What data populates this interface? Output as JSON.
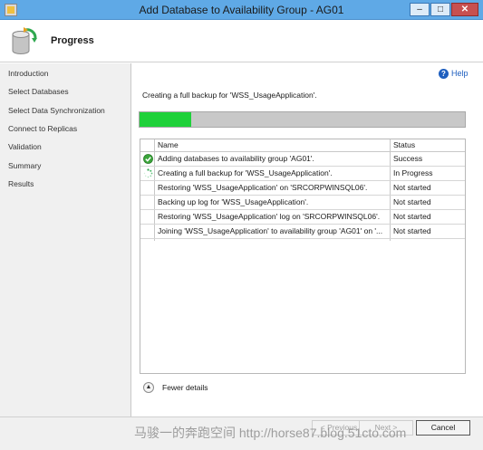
{
  "window": {
    "title": "Add Database to Availability Group - AG01",
    "minimize_glyph": "–",
    "maximize_glyph": "□",
    "close_glyph": "✕"
  },
  "header": {
    "title": "Progress",
    "icon": "database-sync-icon"
  },
  "sidebar": {
    "items": [
      "Introduction",
      "Select Databases",
      "Select Data Synchronization",
      "Connect to Replicas",
      "Validation",
      "Summary",
      "Results"
    ]
  },
  "help": {
    "label": "Help",
    "icon_glyph": "?"
  },
  "status_message": "Creating a full backup for 'WSS_UsageApplication'.",
  "progress": {
    "fraction": 0.16
  },
  "grid": {
    "columns": [
      "Name",
      "Status"
    ],
    "rows": [
      {
        "name": "Adding databases to availability group 'AG01'.",
        "status": "Success",
        "icon": "success-check-icon"
      },
      {
        "name": "Creating a full backup for 'WSS_UsageApplication'.",
        "status": "In Progress",
        "icon": "in-progress-spinner-icon"
      },
      {
        "name": "Restoring 'WSS_UsageApplication' on 'SRCORPWINSQL06'.",
        "status": "Not started",
        "icon": ""
      },
      {
        "name": "Backing up log for 'WSS_UsageApplication'.",
        "status": "Not started",
        "icon": ""
      },
      {
        "name": "Restoring 'WSS_UsageApplication' log on 'SRCORPWINSQL06'.",
        "status": "Not started",
        "icon": ""
      },
      {
        "name": "Joining 'WSS_UsageApplication' to availability group 'AG01' on '...",
        "status": "Not started",
        "icon": ""
      }
    ]
  },
  "details": {
    "label": "Fewer details",
    "toggle_glyph": "▲"
  },
  "footer": {
    "previous_label": "< Previous",
    "next_label": "Next >",
    "cancel_label": "Cancel"
  },
  "watermark": "马骏一的奔跑空间 http://horse87.blog.51cto.com",
  "colors": {
    "titlebar": "#5fa9e6",
    "progress_fill": "#1fd13a",
    "link": "#1f5fbf"
  }
}
